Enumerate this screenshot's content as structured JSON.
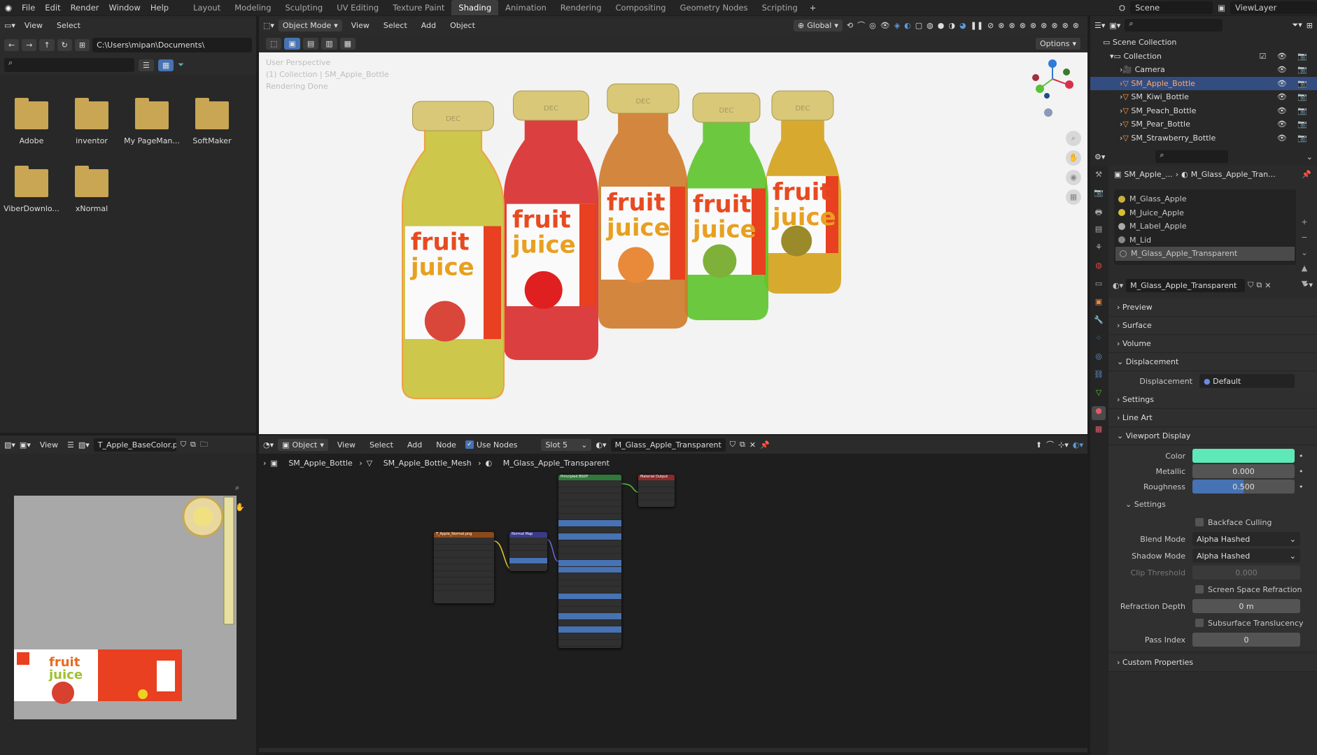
{
  "topbar": {
    "menus": [
      "File",
      "Edit",
      "Render",
      "Window",
      "Help"
    ],
    "workspaces": [
      "Layout",
      "Modeling",
      "Sculpting",
      "UV Editing",
      "Texture Paint",
      "Shading",
      "Animation",
      "Rendering",
      "Compositing",
      "Geometry Nodes",
      "Scripting"
    ],
    "active_workspace": "Shading",
    "scene": "Scene",
    "view_layer": "ViewLayer"
  },
  "filebrowser": {
    "menus": [
      "View",
      "Select"
    ],
    "path": "C:\\Users\\mipan\\Documents\\",
    "folders": [
      "Adobe",
      "inventor",
      "My PageMan...",
      "SoftMaker",
      "ViberDownlo...",
      "xNormal"
    ]
  },
  "viewport": {
    "mode": "Object Mode",
    "menus": [
      "View",
      "Select",
      "Add",
      "Object"
    ],
    "transform": "Global",
    "options": "Options",
    "overlay_lines": [
      "User Perspective",
      "(1) Collection | SM_Apple_Bottle",
      "Rendering Done"
    ],
    "bottles": [
      {
        "name": "apple",
        "liquid": "#c9c23a",
        "fruit": "#d9463a"
      },
      {
        "name": "strawberry",
        "liquid": "#d92b2b",
        "fruit": "#e02020"
      },
      {
        "name": "peach",
        "liquid": "#cf7a2a",
        "fruit": "#e88a3a"
      },
      {
        "name": "kiwi",
        "liquid": "#5dc42b",
        "fruit": "#7fb03a"
      },
      {
        "name": "pear",
        "liquid": "#d4a21a",
        "fruit": "#9a8a2a"
      }
    ],
    "label_text": "fruit juice",
    "cap_text": "DEC"
  },
  "outliner": {
    "root": "Scene Collection",
    "collection": "Collection",
    "items": [
      "Camera",
      "SM_Apple_Bottle",
      "SM_Kiwi_Bottle",
      "SM_Peach_Bottle",
      "SM_Pear_Bottle",
      "SM_Strawberry_Bottle"
    ],
    "selected": "SM_Apple_Bottle"
  },
  "properties": {
    "breadcrumb_object": "SM_Apple_...",
    "breadcrumb_material": "M_Glass_Apple_Tran...",
    "materials": [
      "M_Glass_Apple",
      "M_Juice_Apple",
      "M_Label_Apple",
      "M_Lid",
      "M_Glass_Apple_Transparent"
    ],
    "material_name": "M_Glass_Apple_Transparent",
    "sections": [
      "Preview",
      "Surface",
      "Volume",
      "Displacement"
    ],
    "displacement_label": "Displacement",
    "displacement_value": "Default",
    "sections2": [
      "Settings",
      "Line Art",
      "Viewport Display"
    ],
    "color_label": "Color",
    "color_value": "#5fe8b8",
    "metallic_label": "Metallic",
    "metallic": "0.000",
    "roughness_label": "Roughness",
    "roughness": "0.500",
    "settings_label": "Settings",
    "backface": "Backface Culling",
    "blend_label": "Blend Mode",
    "blend": "Alpha Hashed",
    "shadow_label": "Shadow Mode",
    "shadow": "Alpha Hashed",
    "clip_label": "Clip Threshold",
    "clip": "0.000",
    "ssr": "Screen Space Refraction",
    "refr_label": "Refraction Depth",
    "refr": "0 m",
    "sst": "Subsurface Translucency",
    "pass_label": "Pass Index",
    "pass": "0",
    "custom": "Custom Properties"
  },
  "imageeditor": {
    "view": "View",
    "image": "T_Apple_BaseColor.png"
  },
  "nodeeditor": {
    "mode": "Object",
    "menus": [
      "View",
      "Select",
      "Add",
      "Node"
    ],
    "use_nodes": "Use Nodes",
    "slot": "Slot 5",
    "material": "M_Glass_Apple_Transparent",
    "breadcrumb": [
      "SM_Apple_Bottle",
      "SM_Apple_Bottle_Mesh",
      "M_Glass_Apple_Transparent"
    ],
    "nodes": {
      "bsdf_title": "Principled BSDF",
      "output_title": "Material Output",
      "image_title": "T_Apple_Normal.png",
      "normal_title": "Normal Map"
    }
  }
}
